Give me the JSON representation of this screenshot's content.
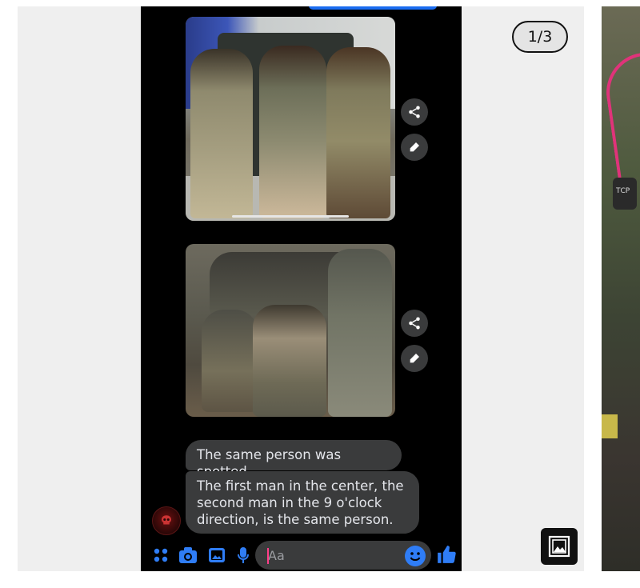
{
  "viewer": {
    "counter": "1/3",
    "gallery_button_icon": "gallery-icon"
  },
  "conversation": {
    "photos": [
      {
        "name": "soldiers-by-vehicle-photo"
      },
      {
        "name": "soldiers-in-trench-photo"
      }
    ],
    "photo_actions": [
      "share-icon",
      "edit-icon"
    ],
    "messages": [
      "The same person was spotted.",
      "The first man in the center, the second man in the 9 o'clock direction, is the same person."
    ]
  },
  "composer": {
    "placeholder": "Aa",
    "value": "",
    "tools": [
      "menu-icon",
      "camera-icon",
      "image-icon",
      "microphone-icon"
    ],
    "emoji_icon": "emoji-icon",
    "like_icon": "thumbs-up-icon"
  },
  "side_image": {
    "patch_text": "ТСР"
  },
  "colors": {
    "accent": "#2f7df6",
    "bubble": "#3a3b3c",
    "bubble_text": "#e4e6eb",
    "background": "#efefef"
  }
}
